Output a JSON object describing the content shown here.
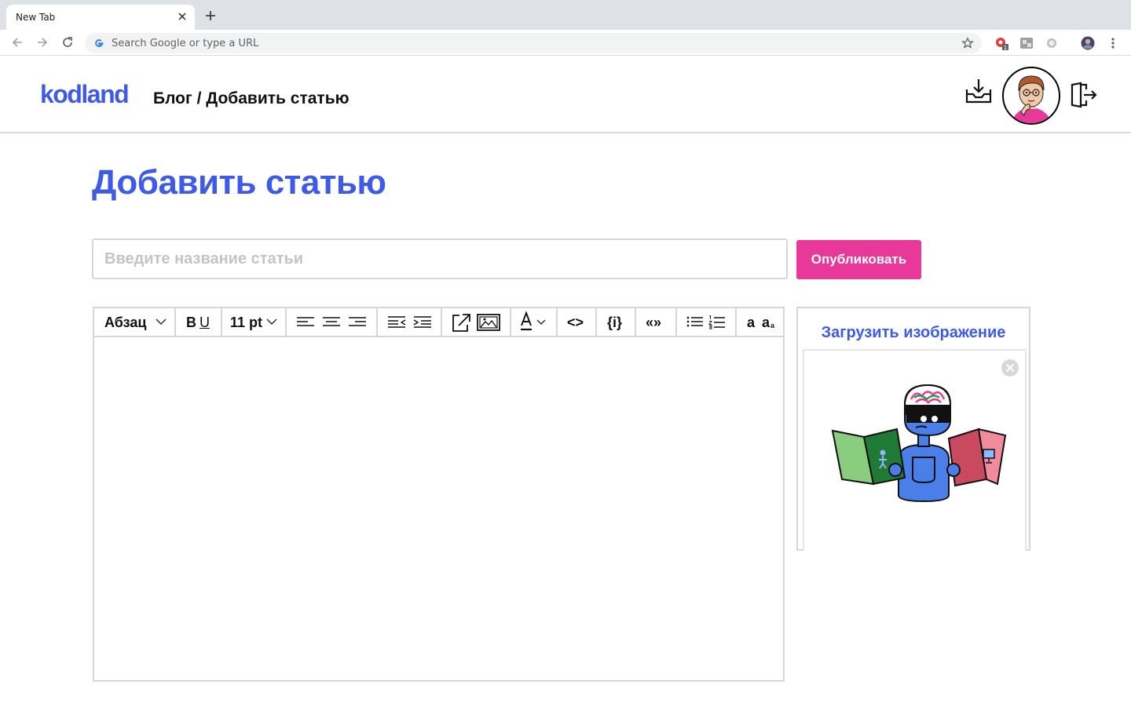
{
  "browser": {
    "tab_title": "New Tab",
    "omnibox_placeholder": "Search Google or type a URL",
    "extension_badge": "1"
  },
  "header": {
    "logo": "kodland",
    "breadcrumb": "Блог / Добавить статью",
    "icons": [
      "inbox-download-icon",
      "avatar",
      "logout-icon"
    ]
  },
  "main": {
    "page_title": "Добавить статью",
    "title_input": {
      "placeholder": "Введите название статьи",
      "value": ""
    },
    "publish_label": "Опубликовать"
  },
  "editor": {
    "paragraph_select": "Абзац",
    "bold": "B",
    "underline": "U",
    "font_size": "11 pt",
    "code": "<>",
    "code_block": "{i}",
    "quote": "«»",
    "case_lower": "a",
    "case_sub": "a",
    "case_sub_small": "a",
    "content": ""
  },
  "upload": {
    "title": "Загрузить изображение",
    "image_icon": "robot-reading-books-illustration"
  },
  "colors": {
    "brand_blue": "#3e5be8",
    "publish_pink": "#e8399a",
    "border_gray": "#d6d6d6"
  }
}
